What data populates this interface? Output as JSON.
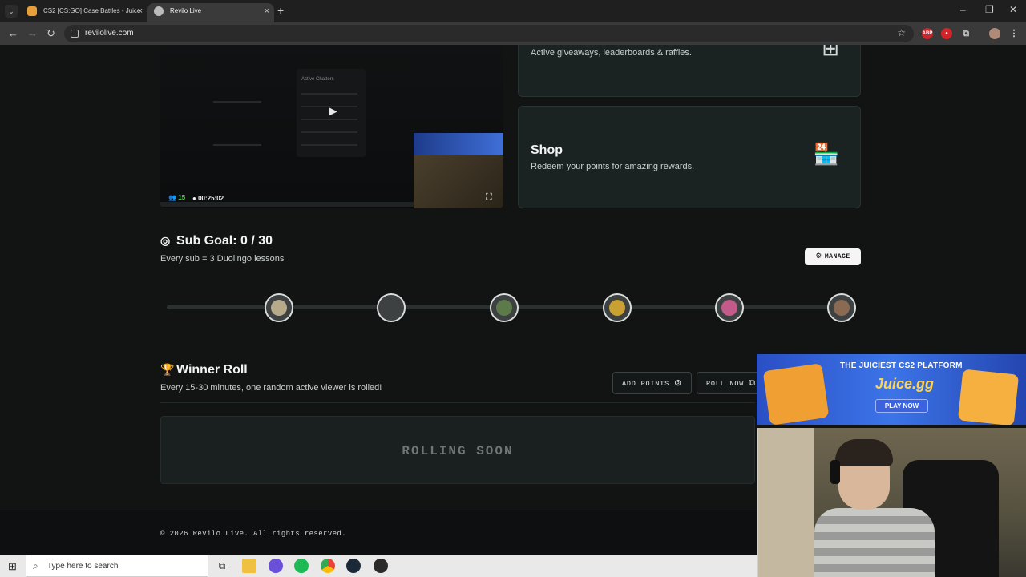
{
  "browser": {
    "tabs": [
      {
        "title": "CS2 [CS:GO] Case Battles - Juice"
      },
      {
        "title": "Revilo Live"
      }
    ],
    "url": "revilolive.com"
  },
  "video": {
    "viewers": "15",
    "time": "00:25:02",
    "chat_title": "Active Chatters"
  },
  "cards": {
    "giveaways_sub": "Active giveaways, leaderboards & raffles.",
    "shop_title": "Shop",
    "shop_sub": "Redeem your points for amazing rewards."
  },
  "sub_goal": {
    "title": "Sub Goal: 0 / 30",
    "subtitle": "Every sub = 3 Duolingo lessons",
    "manage_label": "MANAGE",
    "progress": 0
  },
  "winner_roll": {
    "title": "Winner Roll",
    "subtitle": "Every 15-30 minutes, one random active viewer is rolled!",
    "add_points_label": "ADD POINTS",
    "roll_now_label": "ROLL NOW",
    "status": "ROLLING SOON"
  },
  "footer": {
    "text": "© 2026 Revilo Live. All rights reserved."
  },
  "stream_overlay": {
    "ad_title": "THE JUICIEST CS2 PLATFORM",
    "brand": "Juice.gg",
    "cta": "PLAY NOW"
  },
  "taskbar": {
    "search_placeholder": "Type here to search"
  },
  "colors": {
    "background": "#121414",
    "card": "#1a2222",
    "accent_green": "#5ad15a"
  }
}
